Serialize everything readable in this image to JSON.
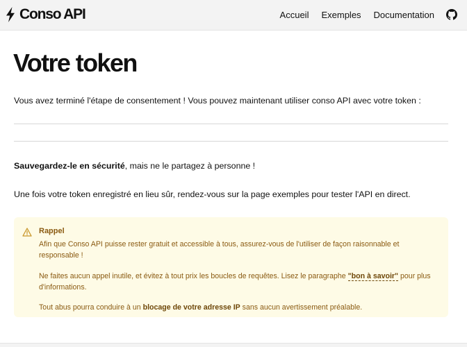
{
  "nav": {
    "brand": "Conso API",
    "links": [
      "Accueil",
      "Exemples",
      "Documentation"
    ]
  },
  "page": {
    "title": "Votre token",
    "intro": "Vous avez terminé l'étape de consentement ! Vous pouvez maintenant utiliser conso API avec votre token :",
    "safe_bold": "Sauvegardez-le en sécurité",
    "safe_rest": ", mais ne le partagez à personne !",
    "next_step": "Une fois votre token enregistré en lieu sûr, rendez-vous sur la page exemples pour tester l'API en direct."
  },
  "alert": {
    "title": "Rappel",
    "p1": "Afin que Conso API puisse rester gratuit et accessible à tous, assurez-vous de l'utiliser de façon raisonnable et responsable !",
    "p2_before": "Ne faites aucun appel inutile, et évitez à tout prix les boucles de requêtes. Lisez le paragraphe ",
    "p2_link": "\"bon à savoir\"",
    "p2_after": " pour plus d'informations.",
    "p3_before": "Tout abus pourra conduire à un ",
    "p3_bold": "blocage de votre adresse IP",
    "p3_after": " sans aucun avertissement préalable."
  },
  "colors": {
    "alert_bg": "#fefbe6",
    "alert_text": "#8a5a11",
    "page_bg": "#f3f3f3"
  },
  "icons": {
    "brand": "lightning-bolt-icon",
    "github": "github-icon",
    "alert": "warning-triangle-icon"
  }
}
